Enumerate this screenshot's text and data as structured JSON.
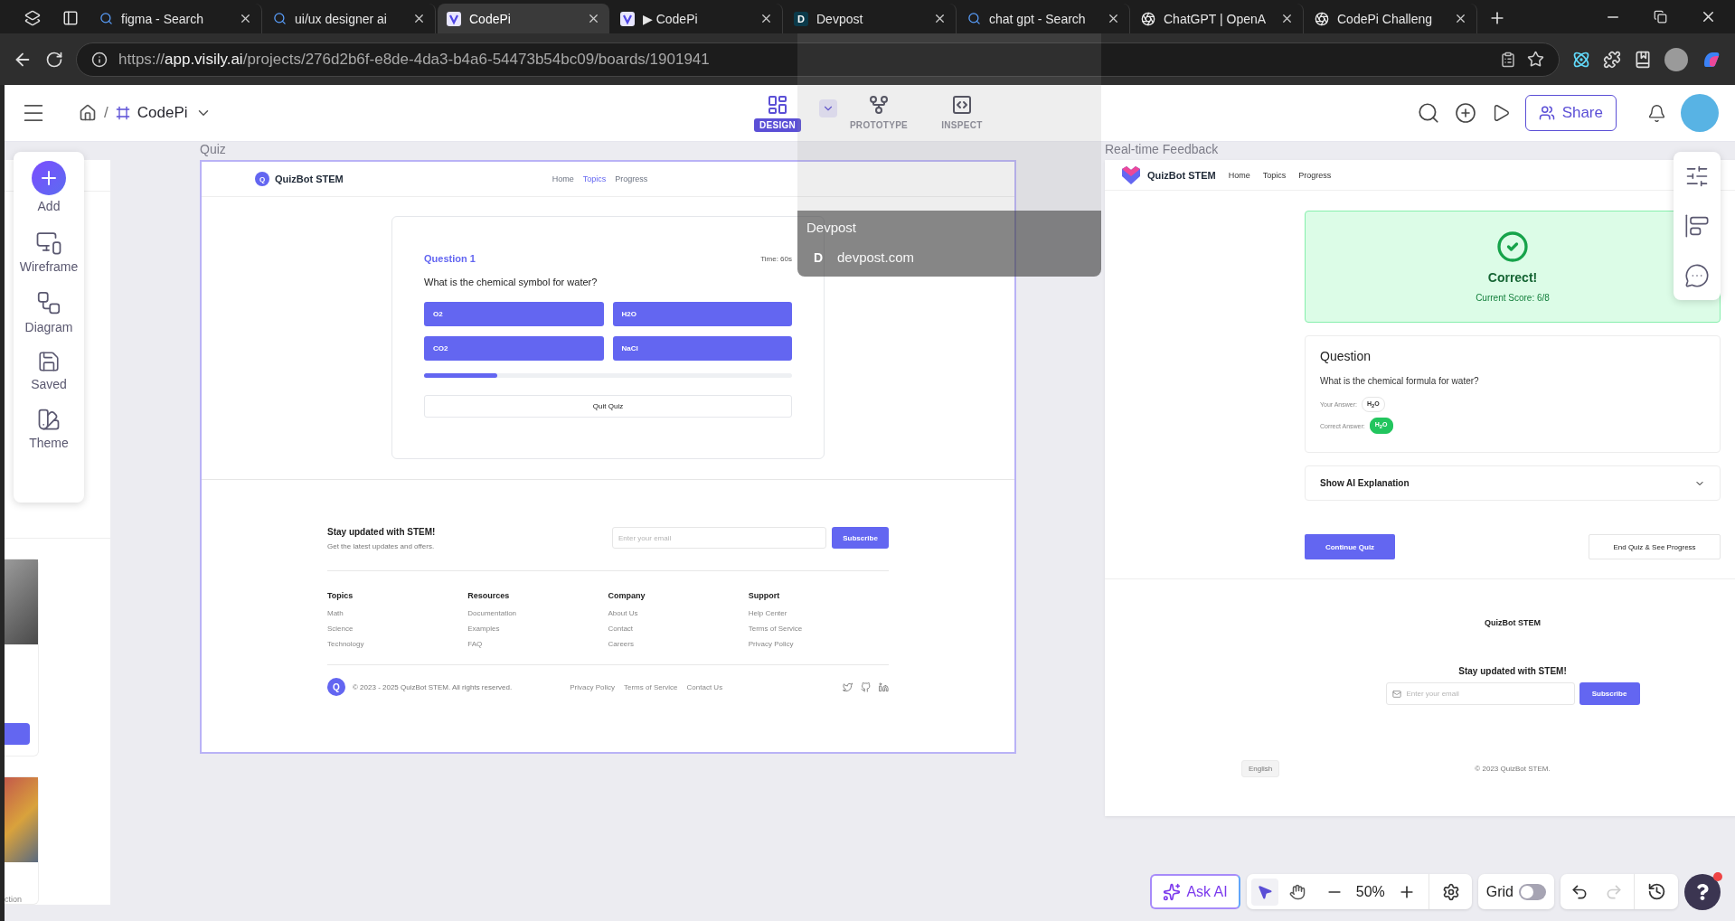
{
  "browser": {
    "tabs": [
      {
        "title": "figma - Search",
        "kind": "search",
        "selected": false
      },
      {
        "title": "ui/ux designer ai",
        "kind": "search",
        "selected": false
      },
      {
        "title": "CodePi",
        "kind": "app",
        "selected": true
      },
      {
        "title": "▶ CodePi",
        "kind": "app",
        "selected": false
      },
      {
        "title": "Devpost",
        "kind": "letter",
        "icon_text": "D",
        "selected": false
      },
      {
        "title": "chat gpt - Search",
        "kind": "search",
        "selected": false
      },
      {
        "title": "ChatGPT | OpenA",
        "kind": "aperture",
        "selected": false
      },
      {
        "title": "CodePi Challeng",
        "kind": "aperture",
        "selected": false
      }
    ],
    "address": {
      "scheme": "https://",
      "host": "app.visily.ai",
      "path": "/projects/276d2b6f-e8de-4da3-b4a6-54473b54bc09/boards/1901941"
    }
  },
  "tab_preview": {
    "title": "Devpost",
    "site_letter": "D",
    "url": "devpost.com"
  },
  "app": {
    "breadcrumb_separator": "/",
    "project": "CodePi",
    "modes": [
      {
        "kind": "design",
        "label": "DESIGN",
        "selected": true
      },
      {
        "kind": "prototype",
        "label": "PROTOTYPE",
        "selected": false
      },
      {
        "kind": "inspect",
        "label": "INSPECT",
        "selected": false
      }
    ],
    "share": "Share"
  },
  "tools": [
    {
      "kind": "add",
      "label": "Add"
    },
    {
      "kind": "wireframe",
      "label": "Wireframe"
    },
    {
      "kind": "diagram",
      "label": "Diagram"
    },
    {
      "kind": "saved",
      "label": "Saved"
    },
    {
      "kind": "theme",
      "label": "Theme"
    }
  ],
  "side_frame": {
    "caption": "ction"
  },
  "quiz_frame": {
    "label": "Quiz",
    "logo_letter": "Q",
    "brand": "QuizBot STEM",
    "nav": [
      {
        "label": "Home",
        "selected": false
      },
      {
        "label": "Topics",
        "selected": true
      },
      {
        "label": "Progress",
        "selected": false
      }
    ],
    "question_number": "Question 1",
    "timer": "Time: 60s",
    "question": "What is the chemical symbol for water?",
    "options": [
      "O2",
      "H2O",
      "CO2",
      "NaCl"
    ],
    "progress": {
      "level": 0.2
    },
    "quit": "Quit Quiz",
    "newsletter": {
      "title": "Stay updated with STEM!",
      "subtitle": "Get the latest updates and offers.",
      "placeholder": "Enter your email",
      "button": "Subscribe"
    },
    "columns": [
      {
        "heading": "Topics",
        "links": [
          "Math",
          "Science",
          "Technology"
        ]
      },
      {
        "heading": "Resources",
        "links": [
          "Documentation",
          "Examples",
          "FAQ"
        ]
      },
      {
        "heading": "Company",
        "links": [
          "About Us",
          "Contact",
          "Careers"
        ]
      },
      {
        "heading": "Support",
        "links": [
          "Help Center",
          "Terms of Service",
          "Privacy Policy"
        ]
      }
    ],
    "footer_logo_letter": "Q",
    "copyright": "© 2023 - 2025 QuizBot STEM. All rights reserved.",
    "legal_links": [
      "Privacy Policy",
      "Terms of Service",
      "Contact Us"
    ]
  },
  "feedback_frame": {
    "label": "Real-time Feedback",
    "brand": "QuizBot STEM",
    "nav": [
      {
        "label": "Home",
        "selected": false
      },
      {
        "label": "Topics",
        "selected": false
      },
      {
        "label": "Progress",
        "selected": false
      }
    ],
    "result": {
      "title": "Correct!",
      "score": "Current Score: 6/8"
    },
    "question_heading": "Question",
    "question": "What is the chemical formula for water?",
    "answers": [
      {
        "label": "Your Answer:",
        "value": "H$_{2}$O",
        "correct": false
      },
      {
        "label": "Correct Answer:",
        "value": "H$_{2}$O",
        "correct": true
      }
    ],
    "explanation": {
      "label": "Show AI Explanation",
      "expanded": false
    },
    "continue": "Continue Quiz",
    "end": "End Quiz & See Progress",
    "footer_brand": "QuizBot STEM",
    "newsletter_title": "Stay updated with STEM!",
    "placeholder": "Enter your email",
    "subscribe": "Subscribe",
    "language": "English",
    "copyright": "© 2023 QuizBot STEM."
  },
  "canvas_tools": {
    "ask_ai": "Ask AI",
    "pointer_tools": [
      {
        "kind": "select",
        "selected": true
      },
      {
        "kind": "hand",
        "selected": false
      }
    ],
    "zoom": "50%",
    "grid": {
      "label": "Grid",
      "on": false
    },
    "help_notification": true
  }
}
